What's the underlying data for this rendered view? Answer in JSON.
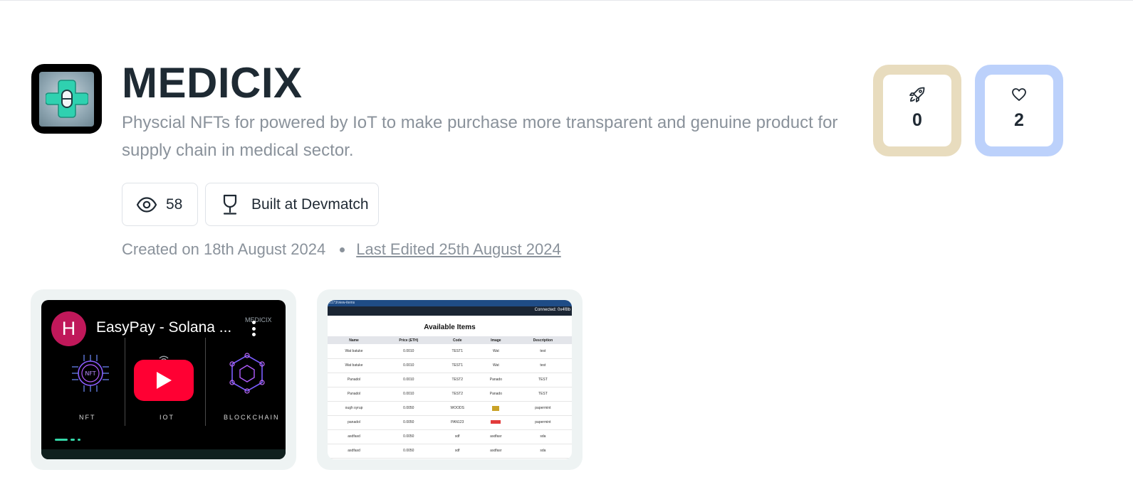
{
  "project": {
    "name": "MEDICIX",
    "description": "Physcial NFTs for powered by IoT to make purchase more transparent and genuine product for supply chain in medical sector.",
    "views": "58",
    "built_at": "Built at Devmatch",
    "created": "Created on 18th August 2024",
    "last_edited": "Last Edited 25th August 2024",
    "logo_icon": "medical-cross-pill-icon"
  },
  "stats": {
    "boosts": "0",
    "likes": "2",
    "boost_icon": "rocket-icon",
    "like_icon": "heart-icon"
  },
  "video": {
    "channel_initial": "H",
    "title": "EasyPay - Solana ...",
    "brand": "MEDICIX",
    "captions": [
      "NFT",
      "IOT",
      "BLOCKCHAIN"
    ]
  },
  "screenshot": {
    "url": "5173/view-items",
    "connected": "Connected: 0x4f8b",
    "heading": "Available Items",
    "columns": [
      "Name",
      "Price (ETH)",
      "Code",
      "Image",
      "Description"
    ],
    "rows": [
      [
        "Wat batuke",
        "0.0010",
        "TEST1",
        "Wat",
        "test"
      ],
      [
        "Wat batuke",
        "0.0010",
        "TEST1",
        "Wat",
        "test"
      ],
      [
        "Panadol",
        "0.0010",
        "TEST2",
        "Panado",
        "TEST"
      ],
      [
        "Panadol",
        "0.0010",
        "TEST2",
        "Panado",
        "TEST"
      ],
      [
        "ough syrup",
        "0.0050",
        "WOODS",
        "",
        "papermint"
      ],
      [
        "panadol",
        "0.0050",
        "PAN123",
        "",
        "papermint"
      ],
      [
        "asdfasd",
        "0.0050",
        "sdf",
        "asdfasr",
        "sda"
      ],
      [
        "asdfasd",
        "0.0050",
        "sdf",
        "asdfasr",
        "sda"
      ]
    ]
  },
  "colors": {
    "title": "#1e2a33",
    "muted": "#8a929b",
    "boost_bg": "#e8dcbe",
    "like_bg": "#bcd1fb",
    "media_bg": "#eef3f3",
    "avatar": "#c0185a",
    "play": "#ff0033"
  }
}
